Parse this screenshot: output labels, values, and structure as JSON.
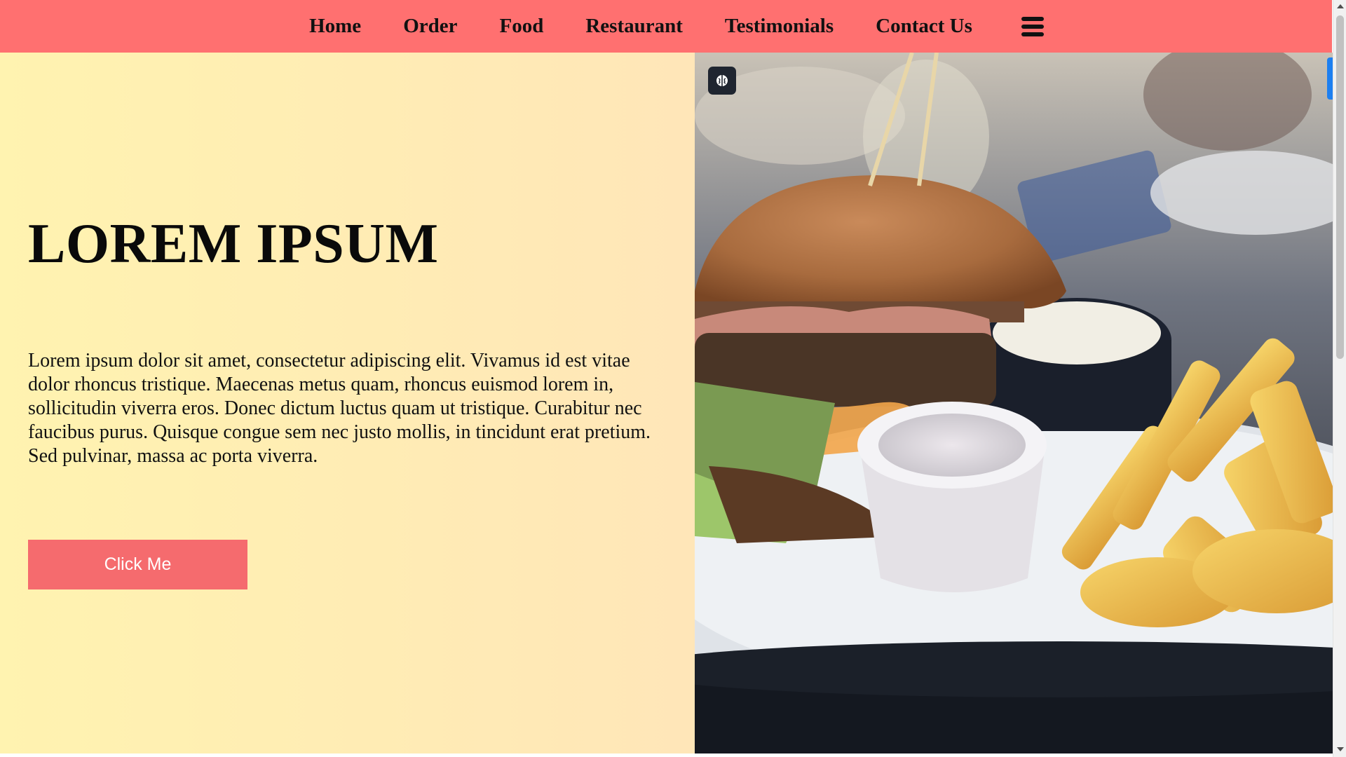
{
  "nav": {
    "items": [
      {
        "label": "Home"
      },
      {
        "label": "Order"
      },
      {
        "label": "Food"
      },
      {
        "label": "Restaurant"
      },
      {
        "label": "Testimonials"
      },
      {
        "label": "Contact Us"
      }
    ],
    "menu_icon": "hamburger-menu-icon"
  },
  "hero": {
    "title": "LOREM IPSUM",
    "text": "Lorem ipsum dolor sit amet, consectetur adipiscing elit. Vivamus id est vitae dolor rhoncus tristique. Maecenas metus quam, rhoncus euismod lorem in, sollicitudin viverra eros. Donec dictum luctus quam ut tristique. Curabitur nec faucibus purus. Quisque congue sem nec justo mollis, in tincidunt erat pretium. Sed pulvinar, massa ac porta viverra.",
    "button_label": "Click Me",
    "image_icon": "burger-and-fries-photo"
  },
  "overlay": {
    "extension_icon": "brain-icon"
  },
  "colors": {
    "nav_bg": "#ff7070",
    "button_bg": "#f56b6e",
    "hero_gradient_start": "#fff3b0",
    "hero_gradient_end": "#ffe6b8"
  }
}
